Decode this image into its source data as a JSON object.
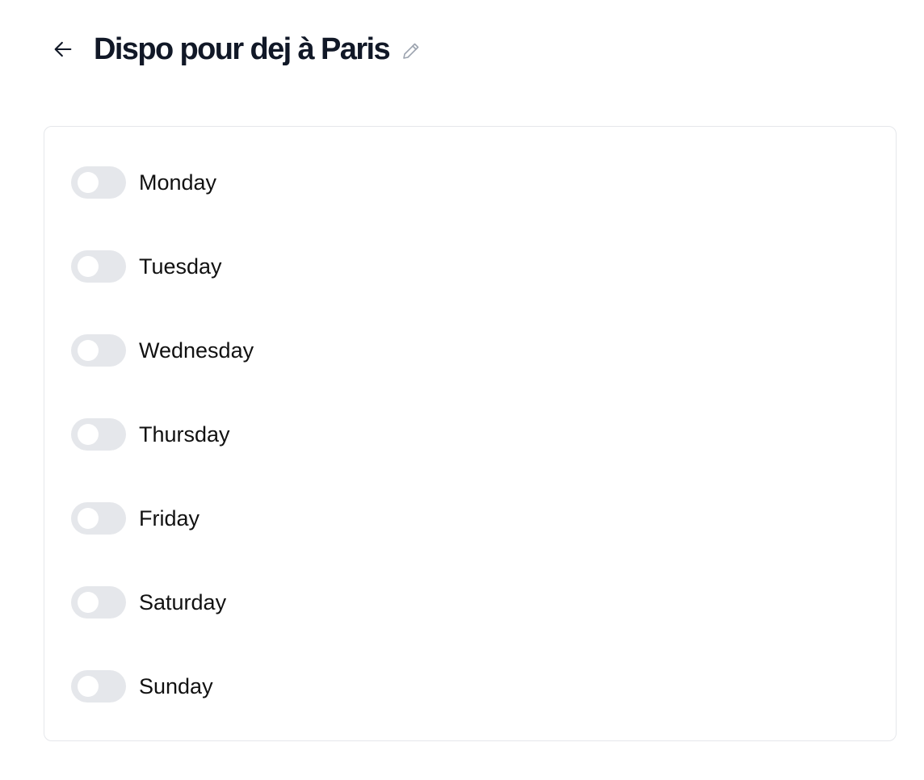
{
  "header": {
    "back_icon": "arrow-left-icon",
    "title": "Dispo pour dej à Paris",
    "edit_icon": "pencil-icon"
  },
  "schedule": {
    "days": [
      {
        "label": "Monday",
        "enabled": false
      },
      {
        "label": "Tuesday",
        "enabled": false
      },
      {
        "label": "Wednesday",
        "enabled": false
      },
      {
        "label": "Thursday",
        "enabled": false
      },
      {
        "label": "Friday",
        "enabled": false
      },
      {
        "label": "Saturday",
        "enabled": false
      },
      {
        "label": "Sunday",
        "enabled": false
      }
    ]
  },
  "colors": {
    "title": "#111827",
    "toggle_off": "#e5e7eb",
    "card_border": "#e5e7eb"
  }
}
